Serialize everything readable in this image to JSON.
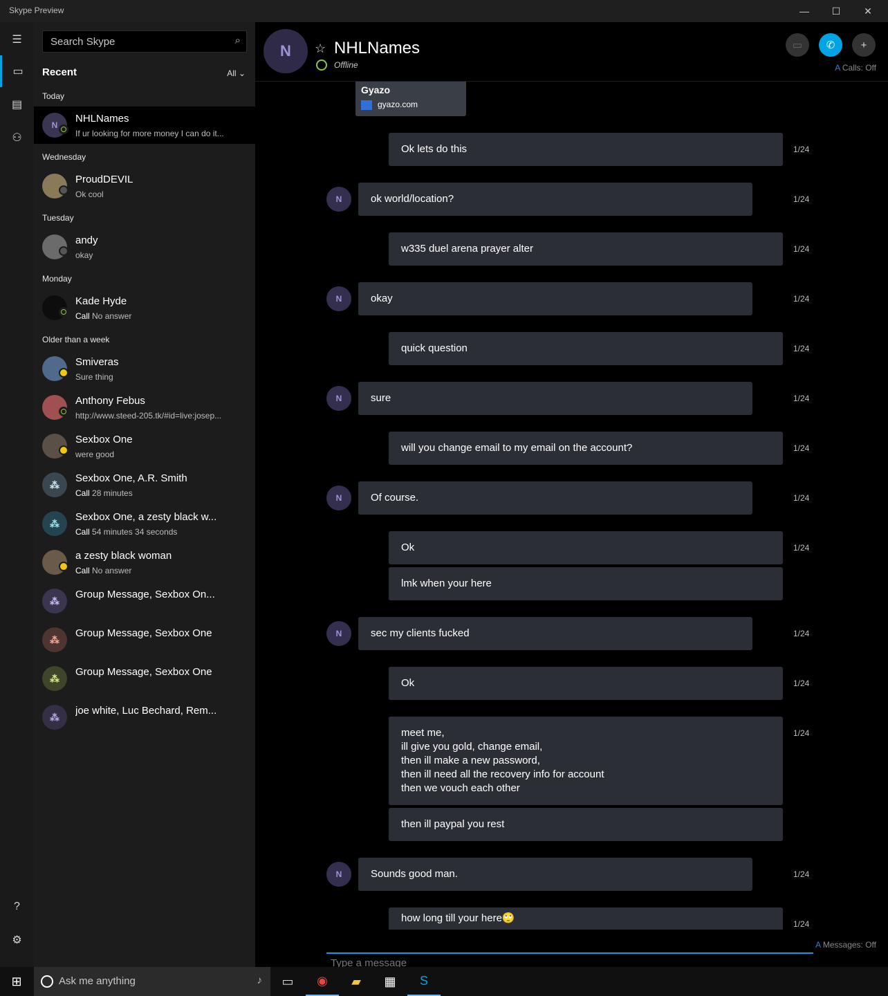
{
  "window": {
    "title": "Skype Preview"
  },
  "search": {
    "placeholder": "Search Skype"
  },
  "sidebar": {
    "recent_label": "Recent",
    "filter_label": "All",
    "groups": {
      "today": "Today",
      "wednesday": "Wednesday",
      "tuesday": "Tuesday",
      "monday": "Monday",
      "older": "Older than a week"
    },
    "conversations": [
      {
        "initial": "N",
        "name": "NHLNames",
        "preview": "If ur looking for more money I can do it..."
      },
      {
        "initial": "",
        "name": "ProudDEVIL",
        "preview": "Ok cool"
      },
      {
        "initial": "",
        "name": "andy",
        "preview": "okay"
      },
      {
        "initial": "",
        "name": "Kade Hyde",
        "preview_bold": "Call",
        "preview": "No answer"
      },
      {
        "initial": "",
        "name": "Smiveras",
        "preview": "Sure thing"
      },
      {
        "initial": "",
        "name": "Anthony Febus",
        "preview": "http://www.steed-205.tk/#id=live:josep..."
      },
      {
        "initial": "",
        "name": "Sexbox One",
        "preview": "were good"
      },
      {
        "initial": "",
        "name": "Sexbox One, A.R. Smith",
        "preview_bold": "Call",
        "preview": "28 minutes"
      },
      {
        "initial": "",
        "name": "Sexbox One, a zesty black w...",
        "preview_bold": "Call",
        "preview": "54 minutes 34 seconds"
      },
      {
        "initial": "",
        "name": "a zesty black woman",
        "preview_bold": "Call",
        "preview": "No answer"
      },
      {
        "initial": "",
        "name": "Group Message, Sexbox On...",
        "preview": ""
      },
      {
        "initial": "",
        "name": "Group Message, Sexbox One",
        "preview": ""
      },
      {
        "initial": "",
        "name": "Group Message, Sexbox One",
        "preview": ""
      },
      {
        "initial": "",
        "name": "joe white, Luc Bechard, Rem...",
        "preview": ""
      }
    ]
  },
  "chat": {
    "initial": "N",
    "name": "NHLNames",
    "status": "Offline",
    "calls_translate": "Calls: Off",
    "messages_translate": "Messages: Off",
    "input_placeholder": "Type a message",
    "link_card": {
      "title": "Gyazo",
      "domain": "gyazo.com"
    },
    "messages": [
      {
        "from": "me",
        "text": "Ok lets do this",
        "time": "1/24"
      },
      {
        "from": "them",
        "text": "ok world/location?",
        "time": "1/24"
      },
      {
        "from": "me",
        "text": "w335 duel arena prayer alter",
        "time": "1/24"
      },
      {
        "from": "them",
        "text": "okay",
        "time": "1/24"
      },
      {
        "from": "me",
        "text": "quick question",
        "time": "1/24"
      },
      {
        "from": "them",
        "text": "sure",
        "time": "1/24"
      },
      {
        "from": "me",
        "text": "will you change email to my email on the account?",
        "time": "1/24"
      },
      {
        "from": "them",
        "text": "Of course.",
        "time": "1/24"
      },
      {
        "from": "me",
        "text": "Ok",
        "time": "1/24"
      },
      {
        "from": "me",
        "text": "lmk when your here",
        "time": ""
      },
      {
        "from": "them",
        "text": "sec my clients fucked",
        "time": "1/24"
      },
      {
        "from": "me",
        "text": "Ok",
        "time": "1/24"
      },
      {
        "from": "me",
        "text": "meet me,\nill give you gold, change email,\nthen ill make a new password,\nthen ill need all the recovery info for account\nthen we vouch each other",
        "time": "1/24"
      },
      {
        "from": "me",
        "text": "then ill paypal you rest",
        "time": ""
      },
      {
        "from": "them",
        "text": "Sounds good man.",
        "time": "1/24"
      },
      {
        "from": "me",
        "text": "how long till your here🙄",
        "time": "1/24"
      }
    ]
  },
  "taskbar": {
    "search_placeholder": "Ask me anything"
  },
  "colors": {
    "accent": "#00a4e4",
    "online": "#8ec63f",
    "away": "#f2c811",
    "bubble": "#2b2f35"
  }
}
